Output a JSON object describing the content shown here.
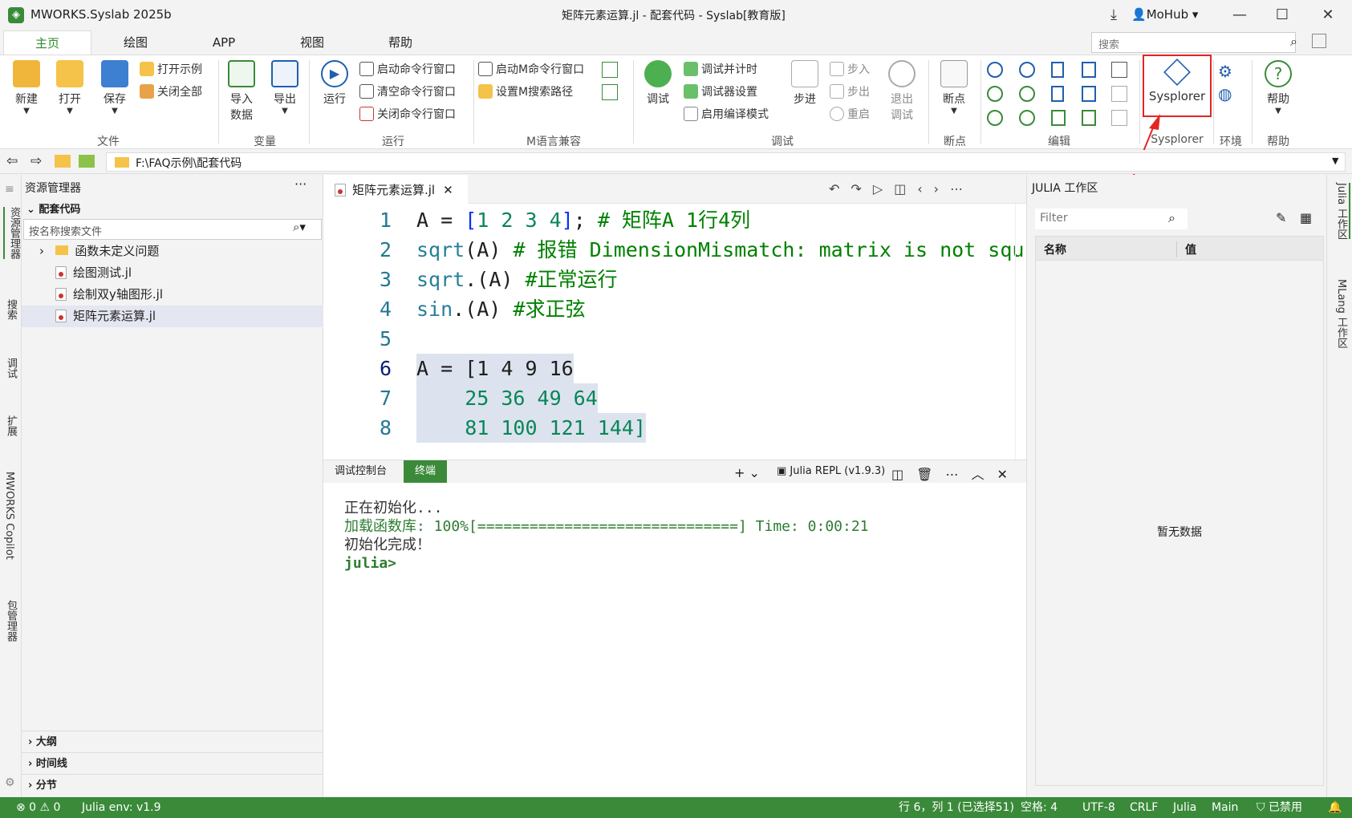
{
  "window": {
    "app_title": "MWORKS.Syslab 2025b",
    "doc_title": "矩阵元素运算.jl - 配套代码 - Syslab[教育版]",
    "user": "MoHub"
  },
  "ribbon_tabs": [
    "主页",
    "绘图",
    "APP",
    "视图",
    "帮助"
  ],
  "search_placeholder": "搜索",
  "ribbon": {
    "new": "新建",
    "open": "打开",
    "save": "保存",
    "open_example": "打开示例",
    "close_all": "关闭全部",
    "import": "导入\n数据",
    "import_l1": "导入",
    "import_l2": "数据",
    "export": "导出",
    "run": "运行",
    "start_cmd": "启动命令行窗口",
    "clear_cmd": "清空命令行窗口",
    "close_cmd": "关闭命令行窗口",
    "start_m": "启动M命令行窗口",
    "set_m_path": "设置M搜索路径",
    "debug": "调试",
    "debug_timer": "调试并计时",
    "debugger_settings": "调试器设置",
    "enable_compile": "启用编译模式",
    "step": "步进",
    "step_in": "步入",
    "step_out": "步出",
    "restart": "重启",
    "exit_debug_l1": "退出",
    "exit_debug_l2": "调试",
    "breakpoint": "断点",
    "sysplorer": "Sysplorer",
    "help": "帮助",
    "groups": {
      "file": "文件",
      "variable": "变量",
      "run": "运行",
      "mlang": "M语言兼容",
      "debug": "调试",
      "breakpoint": "断点",
      "edit": "编辑",
      "sysplorer": "Sysplorer",
      "env": "环境",
      "help": "帮助"
    }
  },
  "address_path": "F:\\FAQ示例\\配套代码",
  "activity_bar": [
    "资源管理器",
    "搜索",
    "调试",
    "扩展",
    "MWORKS Copilot",
    "包管理器"
  ],
  "explorer": {
    "title": "资源管理器",
    "folder": "配套代码",
    "search_placeholder": "按名称搜索文件",
    "items": [
      {
        "label": "函数未定义问题",
        "type": "folder"
      },
      {
        "label": "绘图测试.jl",
        "type": "file"
      },
      {
        "label": "绘制双y轴图形.jl",
        "type": "file"
      },
      {
        "label": "矩阵元素运算.jl",
        "type": "file",
        "selected": true
      }
    ],
    "sections": [
      "大纲",
      "时间线",
      "分节"
    ]
  },
  "editor": {
    "tab": "矩阵元素运算.jl",
    "lines": [
      {
        "n": "1",
        "text": "A = [1 2 3 4]; # 矩阵A 1行4列"
      },
      {
        "n": "2",
        "text": "sqrt(A) # 报错 DimensionMismatch: matrix is not squ"
      },
      {
        "n": "3",
        "text": "sqrt.(A) #正常运行"
      },
      {
        "n": "4",
        "text": "sin.(A) #求正弦"
      },
      {
        "n": "5",
        "text": ""
      },
      {
        "n": "6",
        "text": "A = [1 4 9 16"
      },
      {
        "n": "7",
        "text": "    25 36 49 64"
      },
      {
        "n": "8",
        "text": "    81 100 121 144]"
      }
    ]
  },
  "panel": {
    "tabs": [
      "调试控制台",
      "终端"
    ],
    "repl": "Julia REPL (v1.9.3)",
    "terminal": [
      "正在初始化...",
      "加载函数库: 100%[==============================] Time: 0:00:21",
      "初始化完成！",
      "julia>"
    ]
  },
  "workspace": {
    "title": "JULIA 工作区",
    "filter_placeholder": "Filter",
    "col_name": "名称",
    "col_value": "值",
    "empty": "暂无数据"
  },
  "right_bar": [
    "Julia 工作区",
    "MLang 工作区"
  ],
  "status": {
    "problems": "⊗ 0 ⚠ 0",
    "env": "Julia env: v1.9",
    "cursor": "行 6，列 1 (已选择51)",
    "spaces": "空格: 4",
    "encoding": "UTF-8",
    "eol": "CRLF",
    "lang": "Julia",
    "branch": "Main",
    "disabled": "已禁用"
  },
  "colors": {
    "accent": "#3a8a3a",
    "highlight": "#e52424"
  }
}
